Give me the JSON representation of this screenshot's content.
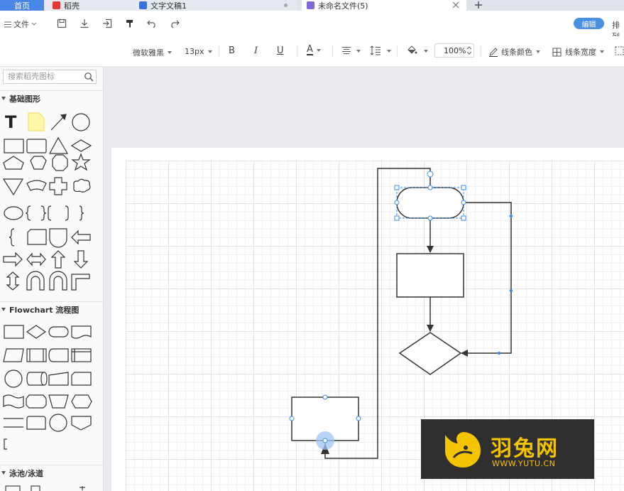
{
  "tabs": [
    {
      "label": "首页"
    },
    {
      "label": "稻壳"
    },
    {
      "label": "文字文稿1"
    },
    {
      "label": "未命名文件(5)"
    }
  ],
  "toolbar": {
    "file_menu": "文件",
    "edit_label": "编辑",
    "arrange_label": "排列"
  },
  "format": {
    "font_family": "微软雅黑",
    "font_size": "13px",
    "bold": "B",
    "italic": "I",
    "underline": "U",
    "font_color": "A",
    "zoom": "100%",
    "line_color": "线条颜色",
    "line_width": "线条宽度"
  },
  "sidebar": {
    "search_placeholder": "搜索稻壳图标",
    "sections": [
      {
        "label": "基础图形"
      },
      {
        "label": "Flowchart 流程图"
      },
      {
        "label": "泳池/泳道"
      }
    ]
  },
  "watermark": {
    "title": "羽兔网",
    "url": "WWW.YUTU.CN"
  },
  "colors": {
    "accent": "#4a90e2",
    "selection": "#3a8ee6",
    "watermark_bg": "#2f2f2f",
    "watermark_fg": "#f5c400"
  }
}
